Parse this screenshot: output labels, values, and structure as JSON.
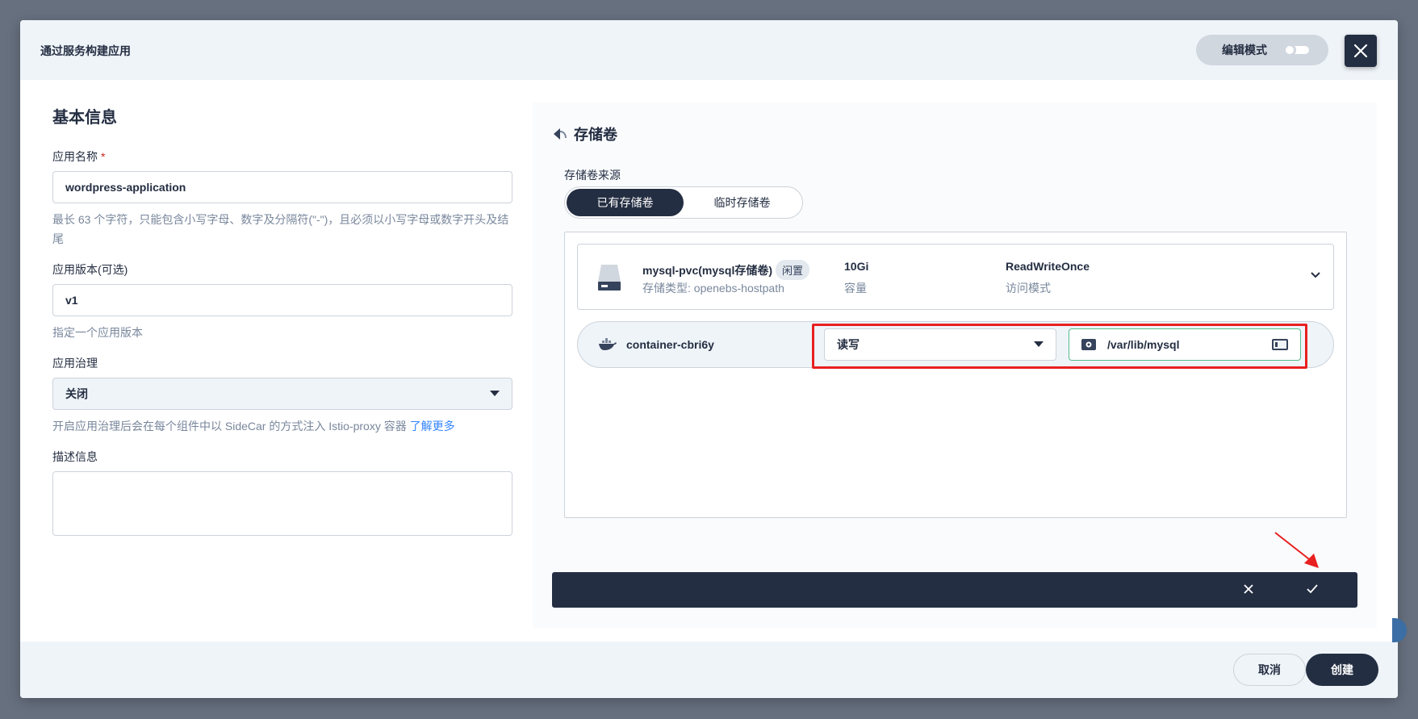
{
  "header": {
    "title": "通过服务构建应用",
    "edit_mode_label": "编辑模式"
  },
  "basic": {
    "section_title": "基本信息",
    "name_label": "应用名称",
    "name_required": "*",
    "name_value": "wordpress-application",
    "name_help": "最长 63 个字符，只能包含小写字母、数字及分隔符(\"-\")，且必须以小写字母或数字开头及结尾",
    "version_label": "应用版本(可选)",
    "version_value": "v1",
    "version_help": "指定一个应用版本",
    "governance_label": "应用治理",
    "governance_value": "关闭",
    "governance_help": "开启应用治理后会在每个组件中以 SideCar 的方式注入 Istio-proxy 容器",
    "governance_link": "了解更多",
    "desc_label": "描述信息"
  },
  "volume": {
    "title": "存储卷",
    "source_label": "存储卷来源",
    "tabs": [
      "已有存储卷",
      "临时存储卷"
    ],
    "active_tab": 0,
    "pvc": {
      "name": "mysql-pvc(mysql存储卷)",
      "status": "闲置",
      "storage_type": "存储类型: openebs-hostpath",
      "capacity_value": "10Gi",
      "capacity_label": "容量",
      "access_mode_value": "ReadWriteOnce",
      "access_mode_label": "访问模式"
    },
    "container": {
      "name": "container-cbri6y",
      "access": "读写",
      "mount_path": "/var/lib/mysql"
    }
  },
  "footer": {
    "cancel_label": "取消",
    "create_label": "创建"
  },
  "colors": {
    "primary_dark": "#242e42",
    "highlight": "#e8201f",
    "link": "#3385ff",
    "success": "#55bc8a"
  }
}
